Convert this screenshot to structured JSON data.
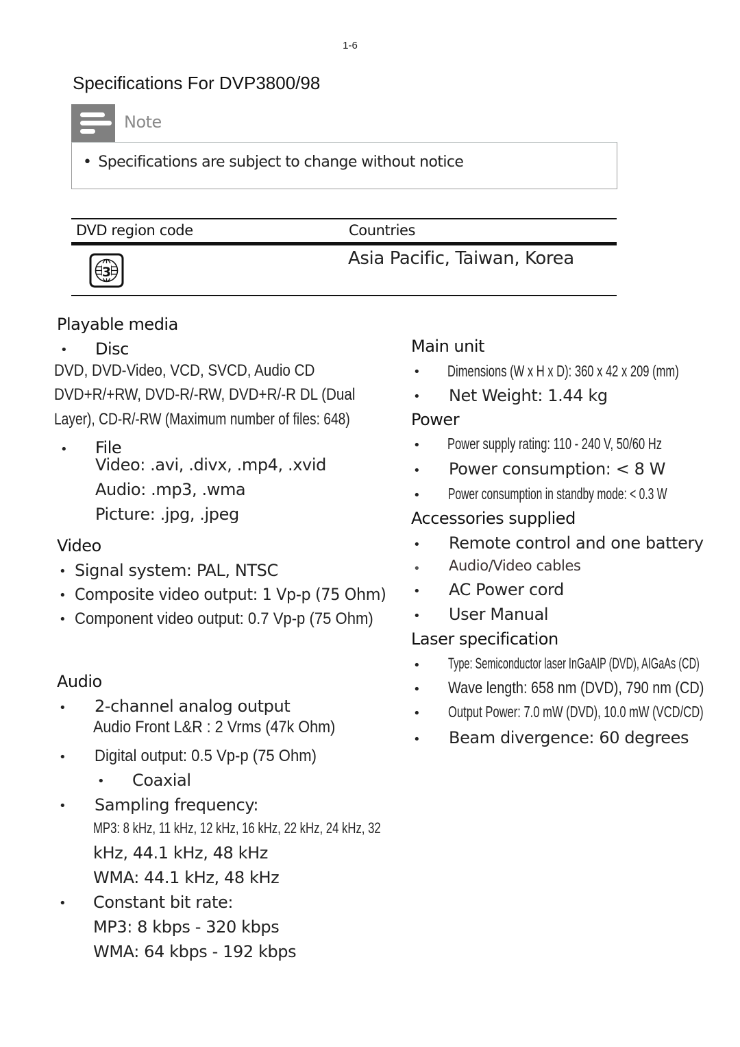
{
  "page_number": "1-6",
  "title": "Specifications For DVP3800/98",
  "note": {
    "label": "Note",
    "items": [
      "Specifications are subject to change without notice"
    ]
  },
  "region_table": {
    "headers": [
      "DVD region code",
      "Countries"
    ],
    "rows": [
      {
        "region_code": "3",
        "countries": "Asia Pacific, Taiwan, Korea"
      }
    ]
  },
  "playable_media": {
    "heading": "Playable media",
    "disc": {
      "label": "Disc",
      "lines": [
        "DVD, DVD-Video, VCD, SVCD, Audio CD",
        "DVD+R/+RW, DVD-R/-RW, DVD+R/-R DL (Dual",
        "Layer), CD-R/-RW (Maximum number of files: 648)"
      ]
    },
    "file": {
      "label": "File",
      "lines": [
        "Video: .avi, .divx, .mp4, .xvid",
        "Audio: .mp3, .wma",
        "Picture: .jpg, .jpeg"
      ]
    }
  },
  "video": {
    "heading": "Video",
    "items": [
      "Signal system: PAL, NTSC",
      "Composite video output: 1 Vp-p (75 Ohm)",
      "Component video output: 0.7 Vp-p (75 Ohm)"
    ]
  },
  "audio": {
    "heading": "Audio",
    "analog": {
      "label": "2-channel analog output",
      "detail": "Audio Front L&R : 2 Vrms (47k Ohm)"
    },
    "digital": {
      "label": "Digital output: 0.5 Vp-p (75 Ohm)",
      "sub": "Coaxial"
    },
    "sampling": {
      "label": "Sampling frequency:",
      "lines": [
        "MP3: 8 kHz, 11 kHz, 12 kHz, 16 kHz, 22 kHz, 24 kHz, 32",
        "kHz, 44.1 kHz, 48 kHz",
        "WMA: 44.1 kHz, 48 kHz"
      ]
    },
    "bitrate": {
      "label": "Constant bit rate:",
      "lines": [
        "MP3: 8 kbps - 320 kbps",
        "WMA: 64 kbps - 192 kbps"
      ]
    }
  },
  "main_unit": {
    "heading": "Main unit",
    "items": [
      "Dimensions (W x H x D): 360 x 42 x 209 (mm)",
      "Net Weight: 1.44 kg"
    ]
  },
  "power": {
    "heading": "Power",
    "items": [
      "Power supply rating: 110 - 240 V, 50/60 Hz",
      "Power consumption: < 8 W",
      "Power consumption in standby mode: < 0.3 W"
    ]
  },
  "accessories": {
    "heading": "Accessories supplied",
    "items": [
      "Remote control and one battery",
      "Audio/Video cables",
      "AC Power cord",
      "User Manual"
    ]
  },
  "laser": {
    "heading": "Laser specification",
    "items": [
      "Type: Semiconductor laser InGaAIP (DVD), AIGaAs (CD)",
      "Wave length: 658 nm (DVD), 790 nm (CD)",
      "Output Power: 7.0 mW (DVD), 10.0 mW (VCD/CD)",
      "Beam divergence: 60 degrees"
    ]
  },
  "bullet_char": "•"
}
